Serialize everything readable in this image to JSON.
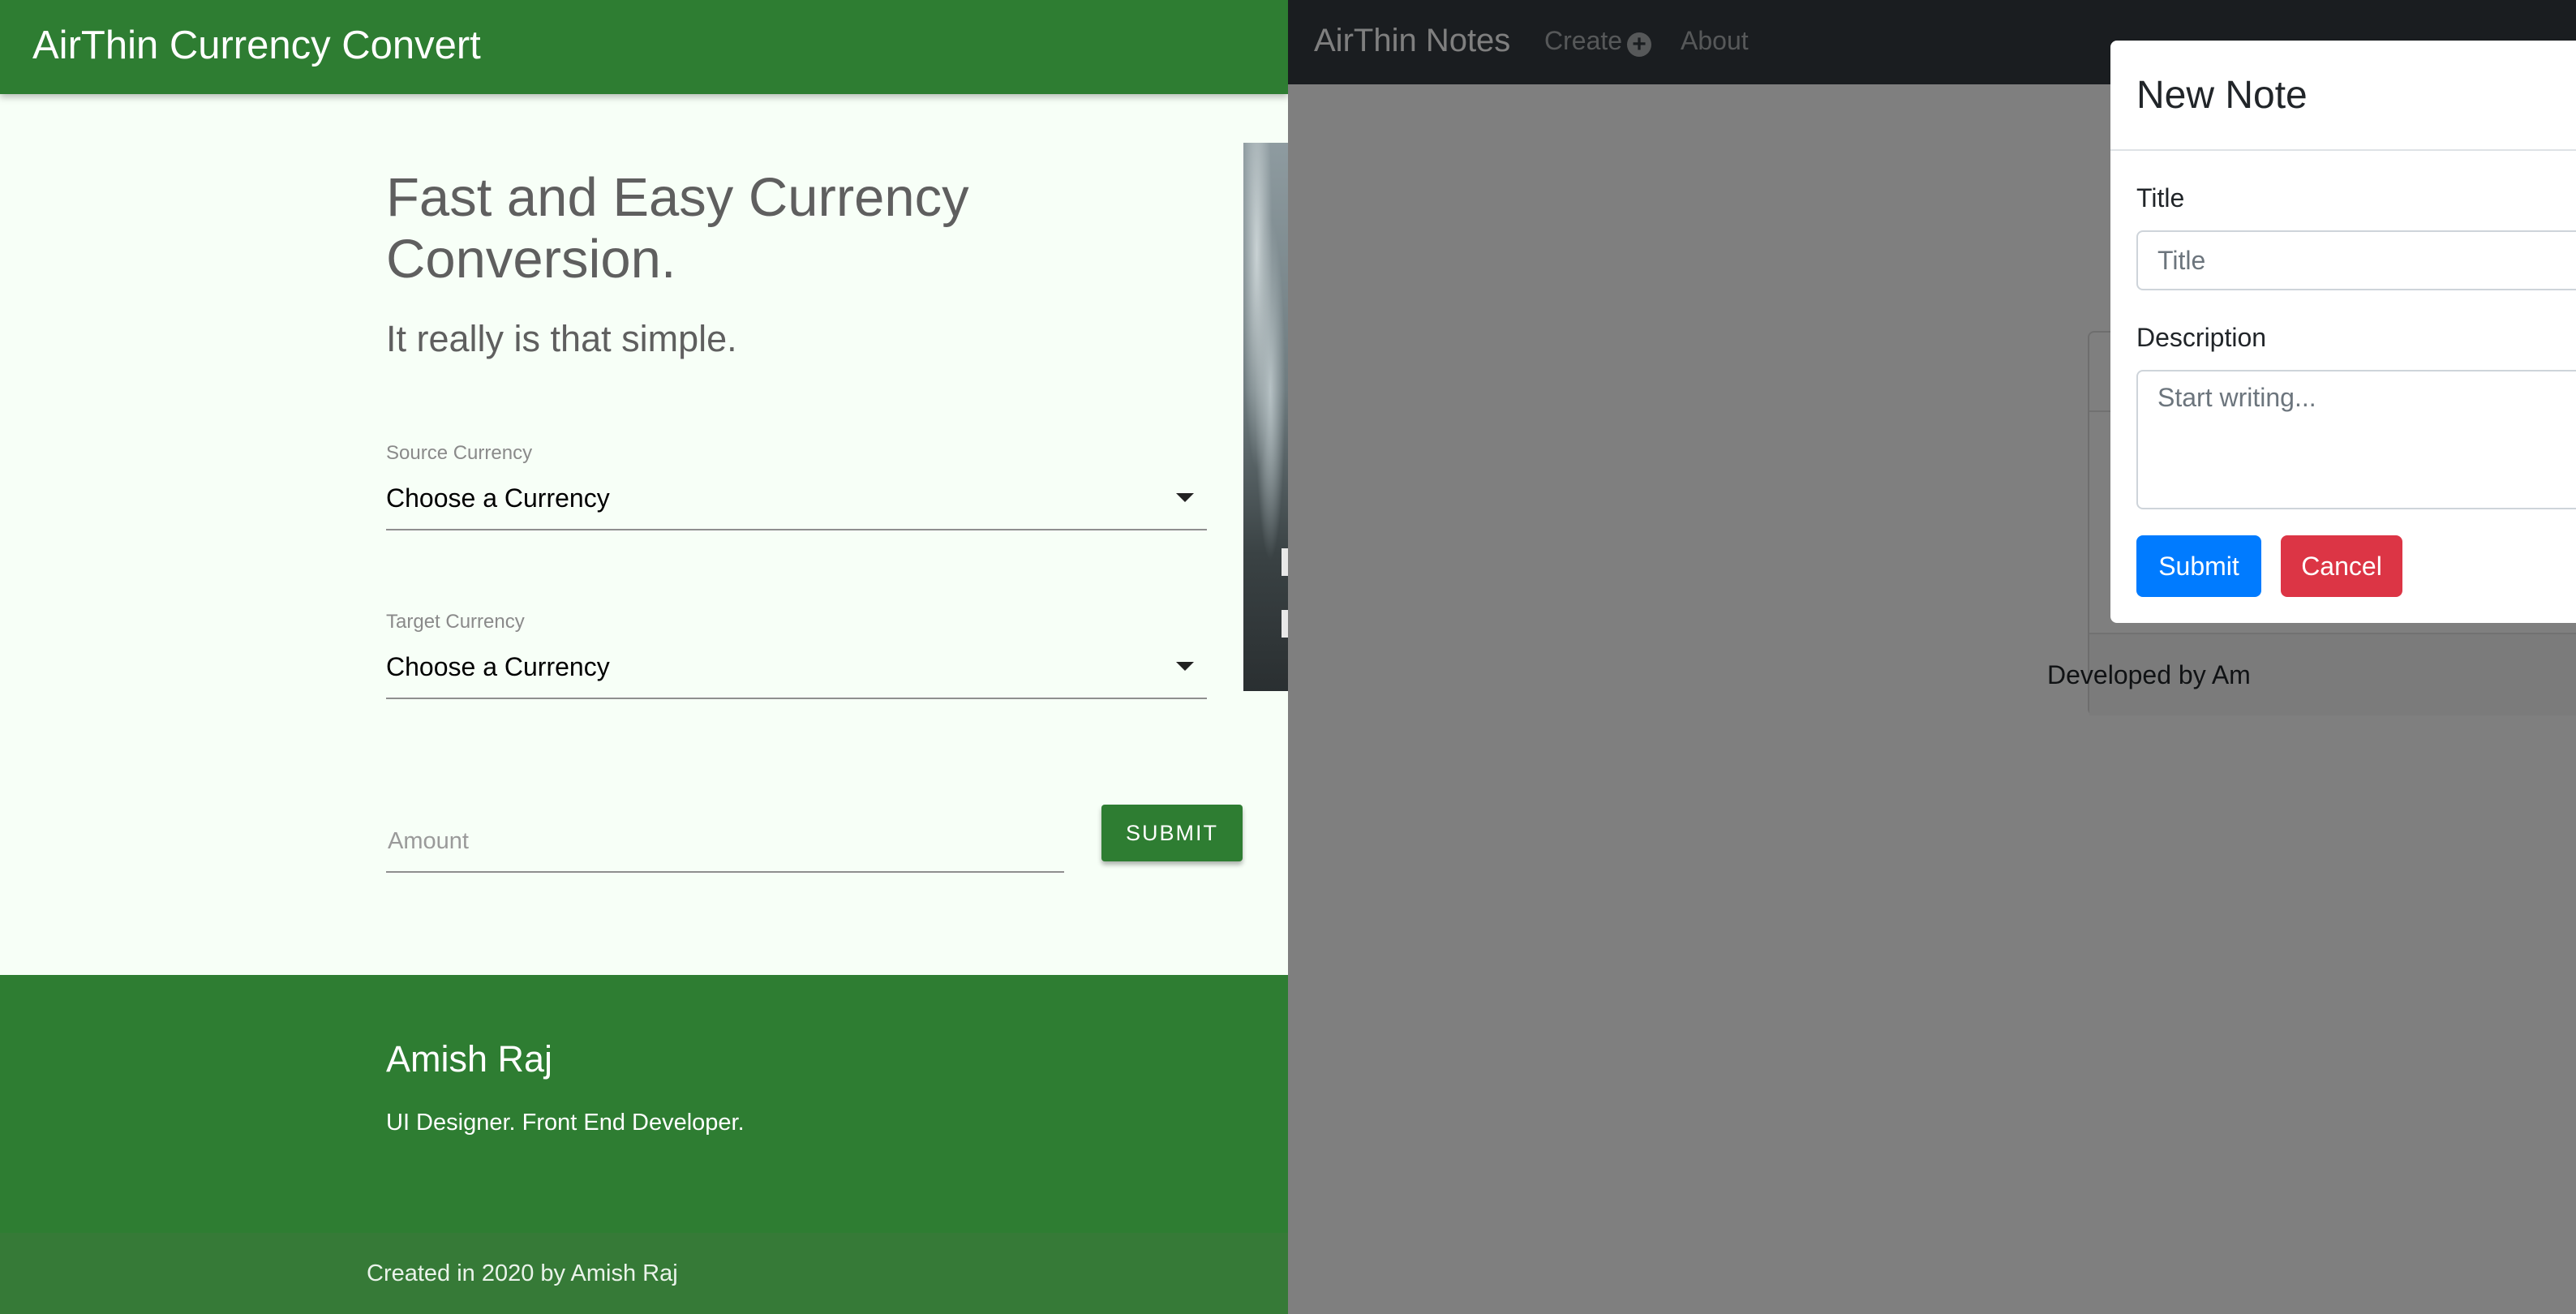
{
  "converter": {
    "brand": "AirThin Currency Convert",
    "hero_title": "Fast and Easy Currency Conversion.",
    "hero_subtitle": "It really is that simple.",
    "source": {
      "label": "Source Currency",
      "value": "Choose a Currency"
    },
    "target": {
      "label": "Target Currency",
      "value": "Choose a Currency"
    },
    "amount": {
      "placeholder": "Amount",
      "value": ""
    },
    "submit_label": "SUBMIT",
    "footer": {
      "name": "Amish Raj",
      "role": "UI Designer. Front End Developer.",
      "copyright": "Created in 2020 by Amish Raj"
    },
    "colors": {
      "primary": "#2e7d32",
      "background": "#f7fff7"
    }
  },
  "notes": {
    "brand": "AirThin Notes",
    "nav": {
      "create": "Create",
      "about": "About"
    },
    "card_footer": "Developed by Am",
    "modal": {
      "title": "New Note",
      "title_label": "Title",
      "title_placeholder": "Title",
      "description_label": "Description",
      "description_placeholder": "Start writing...",
      "submit_label": "Submit",
      "cancel_label": "Cancel"
    },
    "colors": {
      "navbar": "#343a40",
      "primary": "#007bff",
      "danger": "#dc3545"
    }
  }
}
